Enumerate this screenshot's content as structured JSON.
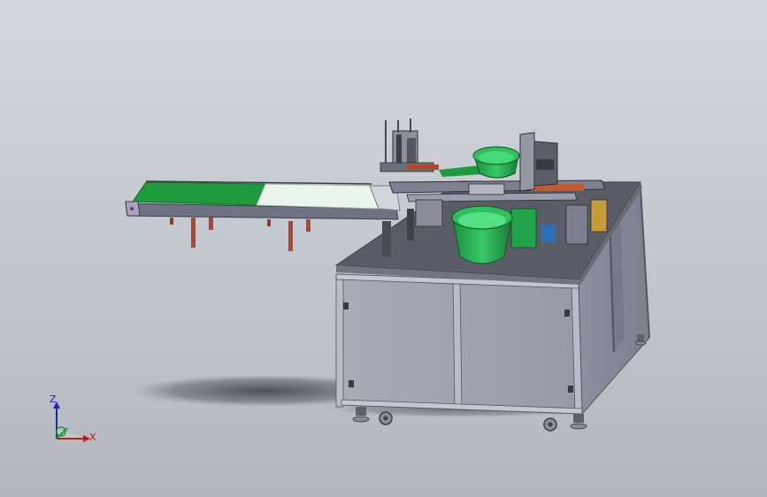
{
  "scene": {
    "background_top": "#d3d6dd",
    "background_bottom": "#b4b7bd",
    "frame_color": "#7a7c86",
    "panel_color": "#9fa2ac",
    "accent_green": "#2fbf5f",
    "conveyor_belt_color": "#1f9a3f",
    "conveyor_white_color": "#eaf5ee"
  },
  "triad": {
    "z_label": "Z",
    "x_label": "X",
    "z_color": "#1b2aa8",
    "x_color": "#c01a1a",
    "y_color": "#1f9a3f"
  }
}
